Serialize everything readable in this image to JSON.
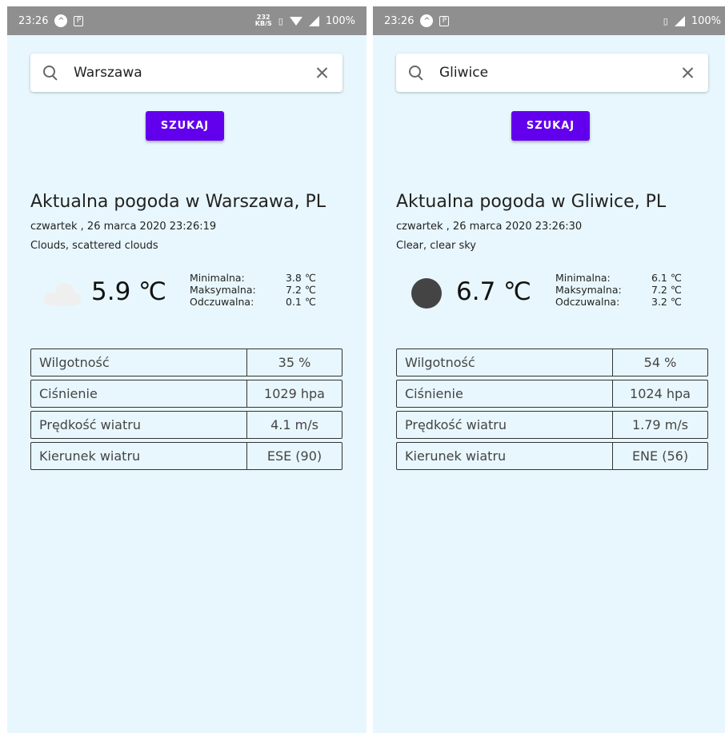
{
  "screens": [
    {
      "status": {
        "time": "23:26",
        "speed_top": "232",
        "speed_bottom": "KB/S",
        "battery": "100%"
      },
      "search": {
        "value": "Warszawa"
      },
      "button_label": "SZUKAJ",
      "weather": {
        "title": "Aktualna pogoda w Warszawa, PL",
        "datetime": "czwartek , 26 marca 2020 23:26:19",
        "description": "Clouds, scattered clouds",
        "icon": "cloud-icon",
        "temp": "5.9 ℃",
        "min_label": "Minimalna:",
        "min_value": "3.8 ℃",
        "max_label": "Maksymalna:",
        "max_value": "7.2 ℃",
        "feel_label": "Odczuwalna:",
        "feel_value": "0.1 ℃"
      },
      "details": [
        {
          "label": "Wilgotność",
          "value": "35 %"
        },
        {
          "label": "Ciśnienie",
          "value": "1029 hpa"
        },
        {
          "label": "Prędkość wiatru",
          "value": "4.1 m/s"
        },
        {
          "label": "Kierunek wiatru",
          "value": "ESE (90)"
        }
      ]
    },
    {
      "status": {
        "time": "23:26",
        "battery": "100%"
      },
      "search": {
        "value": "Gliwice"
      },
      "button_label": "SZUKAJ",
      "weather": {
        "title": "Aktualna pogoda w Gliwice, PL",
        "datetime": "czwartek , 26 marca 2020 23:26:30",
        "description": "Clear, clear sky",
        "icon": "sun-icon",
        "temp": "6.7 ℃",
        "min_label": "Minimalna:",
        "min_value": "6.1 ℃",
        "max_label": "Maksymalna:",
        "max_value": "7.2 ℃",
        "feel_label": "Odczuwalna:",
        "feel_value": "3.2 ℃"
      },
      "details": [
        {
          "label": "Wilgotność",
          "value": "54 %"
        },
        {
          "label": "Ciśnienie",
          "value": "1024 hpa"
        },
        {
          "label": "Prędkość wiatru",
          "value": "1.79 m/s"
        },
        {
          "label": "Kierunek wiatru",
          "value": "ENE (56)"
        }
      ]
    }
  ],
  "colors": {
    "background": "#e8f7fd",
    "statusbar": "#8f8f8f",
    "button": "#6200ee",
    "caret": "#00a58a"
  }
}
